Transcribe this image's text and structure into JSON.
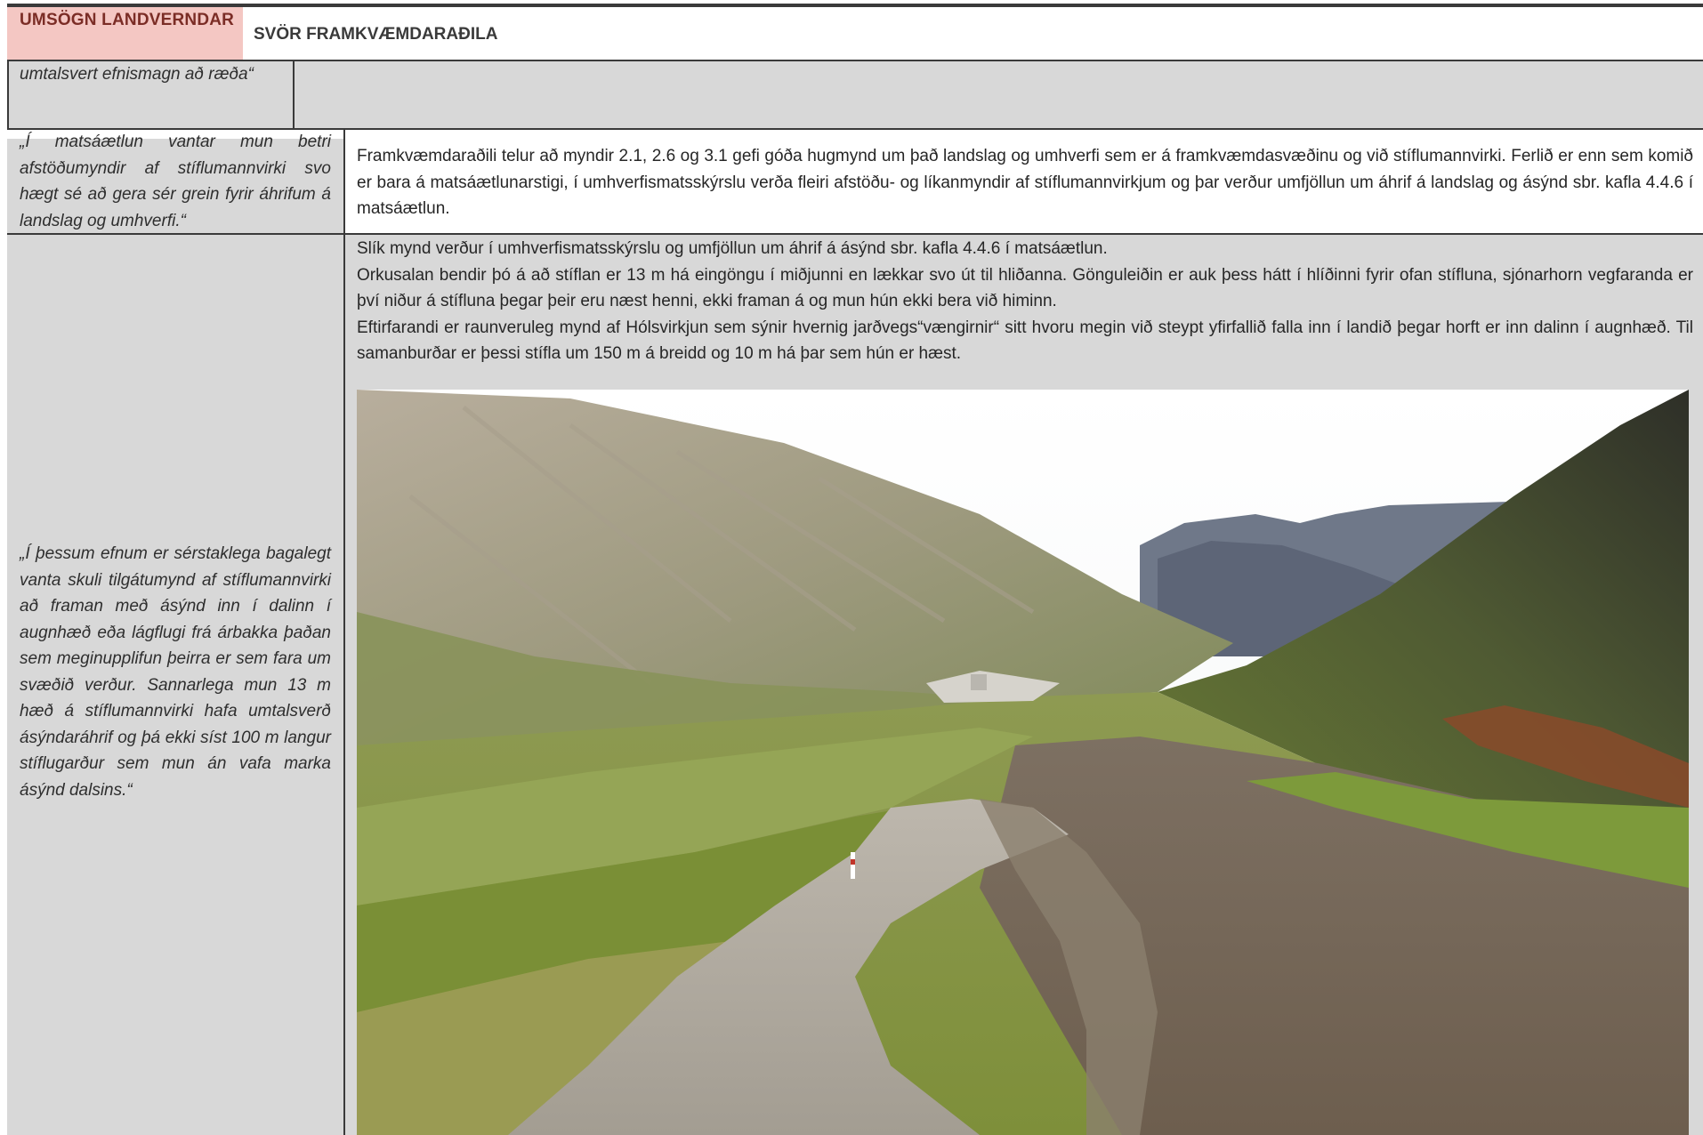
{
  "header": {
    "left_label": "UMSÖGN LANDVERNDAR",
    "right_label": "SVÖR FRAMKVÆMDARAÐILA"
  },
  "rows": [
    {
      "quote": "umtalsvert efnismagn að ræða“",
      "response": []
    },
    {
      "quote": "„Í matsáætlun vantar mun betri afstöðumyndir af stíflumannvirki svo hægt sé að gera sér grein fyrir áhrifum á landslag og umhverfi.“",
      "response": [
        "Framkvæmdaraðili telur að myndir 2.1, 2.6 og 3.1 gefi góða hugmynd um það landslag og umhverfi sem er á framkvæmdasvæðinu og við stíflumannvirki. Ferlið er enn sem komið er bara á matsáætlunarstigi, í umhverfismatsskýrslu verða fleiri afstöðu- og líkanmyndir af stíflumannvirkjum og þar verður umfjöllun um áhrif á landslag og ásýnd sbr. kafla 4.4.6 í matsáætlun."
      ]
    },
    {
      "quote": "„Í þessum efnum er sérstaklega bagalegt vanta skuli tilgátumynd af stíflumannvirki að framan með ásýnd inn í dalinn í augnhæð eða lágflugi frá árbakka þaðan sem meginupplifun þeirra er sem fara um svæðið verður. Sannarlega mun 13 m hæð á stíflumannvirki hafa umtalsverð ásýndaráhrif og þá ekki síst 100 m langur stíflugarður sem mun án vafa marka ásýnd dalsins.“",
      "response": [
        "Slík mynd verður í umhverfismatsskýrslu og umfjöllun um áhrif á ásýnd sbr. kafla 4.4.6 í matsáætlun.",
        "Orkusalan bendir þó á að stíflan er 13 m há eingöngu í miðjunni en lækkar svo út til hliðanna. Gönguleiðin er auk þess hátt í hlíðinni fyrir ofan stífluna, sjónarhorn vegfaranda er því niður á stífluna þegar þeir eru næst henni, ekki framan á og mun hún ekki bera við himinn.",
        "Eftirfarandi er raunveruleg mynd af Hólsvirkjun sem sýnir hvernig jarðvegs“vængirnir“ sitt hvoru megin við steypt yfirfallið falla inn í landið þegar horft er inn dalinn í augnhæð. Til samanburðar er þessi stífla um 150 m á breidd og 10 m há þar sem hún er hæst."
      ]
    }
  ],
  "colors": {
    "header_bg": "#f4c7c3",
    "header_text": "#7b2d26",
    "cell_grey": "#d8d8d8",
    "border": "#3a3a3a"
  }
}
